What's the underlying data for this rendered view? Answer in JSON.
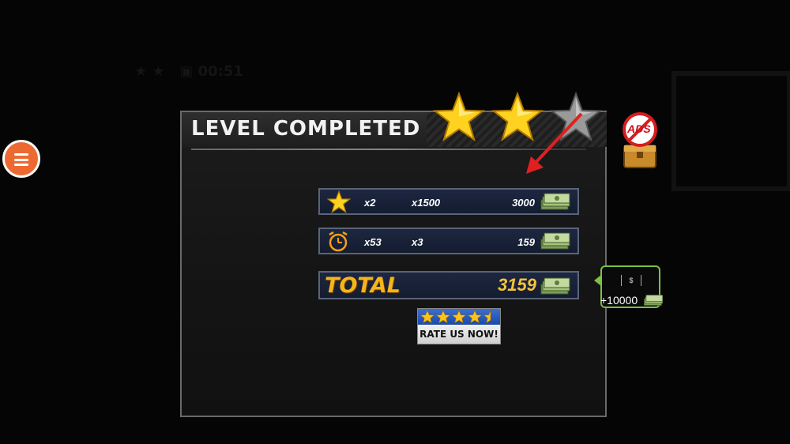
{
  "panel": {
    "title": "LEVEL COMPLETED",
    "stars_earned": 2,
    "stars_total": 3
  },
  "rows": [
    {
      "icon": "star-icon",
      "count": "x2",
      "multiplier": "x1500",
      "amount": "3000"
    },
    {
      "icon": "clock-icon",
      "count": "x53",
      "multiplier": "x3",
      "amount": "159"
    }
  ],
  "total": {
    "label": "TOTAL",
    "value": "3159"
  },
  "rate_button": {
    "label": "RATE US NOW!"
  },
  "ads_button": {
    "label": "ADS"
  },
  "reward": {
    "icon_text": "$",
    "amount": "+10000"
  },
  "colors": {
    "accent_orange": "#ec6a32",
    "total_gold": "#f6b51c",
    "reward_green": "#7bc142",
    "arrow_red": "#e02020"
  }
}
